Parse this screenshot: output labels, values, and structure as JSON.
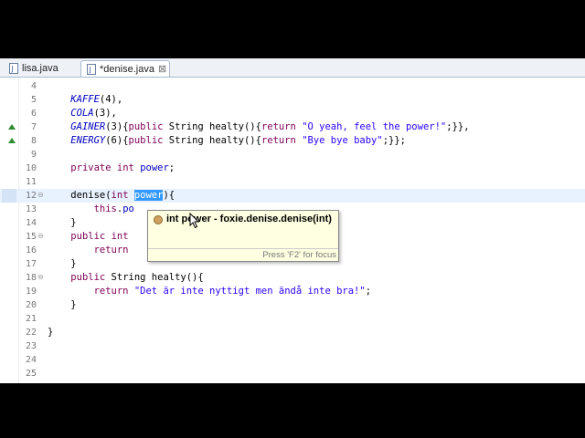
{
  "tabs": [
    {
      "label": "lisa.java",
      "active": false
    },
    {
      "label": "*denise.java",
      "active": true,
      "close": "⊠"
    }
  ],
  "editor": {
    "lines": [
      {
        "num": "4",
        "code": []
      },
      {
        "num": "5",
        "code": [
          {
            "t": "    "
          },
          {
            "t": "KAFFE",
            "c": "en"
          },
          {
            "t": "(4),"
          }
        ]
      },
      {
        "num": "6",
        "code": [
          {
            "t": "    "
          },
          {
            "t": "COLA",
            "c": "en"
          },
          {
            "t": "(3),"
          }
        ]
      },
      {
        "num": "7",
        "overrideMarker": true,
        "code": [
          {
            "t": "    "
          },
          {
            "t": "GAINER",
            "c": "en"
          },
          {
            "t": "(3){"
          },
          {
            "t": "public",
            "c": "kw"
          },
          {
            "t": " String healty(){"
          },
          {
            "t": "return",
            "c": "kw"
          },
          {
            "t": " "
          },
          {
            "t": "\"O yeah, feel the power!\"",
            "c": "st"
          },
          {
            "t": ";}},"
          }
        ]
      },
      {
        "num": "8",
        "overrideMarker": true,
        "code": [
          {
            "t": "    "
          },
          {
            "t": "ENERGY",
            "c": "en"
          },
          {
            "t": "(6){"
          },
          {
            "t": "public",
            "c": "kw"
          },
          {
            "t": " String healty(){"
          },
          {
            "t": "return",
            "c": "kw"
          },
          {
            "t": " "
          },
          {
            "t": "\"Bye bye baby\"",
            "c": "st"
          },
          {
            "t": ";}};"
          }
        ]
      },
      {
        "num": "9",
        "code": []
      },
      {
        "num": "10",
        "code": [
          {
            "t": "    "
          },
          {
            "t": "private",
            "c": "kw"
          },
          {
            "t": " "
          },
          {
            "t": "int",
            "c": "kw"
          },
          {
            "t": " "
          },
          {
            "t": "power",
            "c": "fd"
          },
          {
            "t": ";"
          }
        ]
      },
      {
        "num": "11",
        "code": []
      },
      {
        "num": "12",
        "current": true,
        "fold": "⊖",
        "code": [
          {
            "t": "    denise("
          },
          {
            "t": "int",
            "c": "kw"
          },
          {
            "t": " "
          },
          {
            "t": "power",
            "c": "sel"
          },
          {
            "t": "){"
          }
        ]
      },
      {
        "num": "13",
        "code": [
          {
            "t": "        "
          },
          {
            "t": "this",
            "c": "kw"
          },
          {
            "t": "."
          },
          {
            "t": "po",
            "c": "fd"
          }
        ]
      },
      {
        "num": "14",
        "code": [
          {
            "t": "    }"
          }
        ]
      },
      {
        "num": "15",
        "fold": "⊖",
        "code": [
          {
            "t": "    "
          },
          {
            "t": "public",
            "c": "kw"
          },
          {
            "t": " "
          },
          {
            "t": "int",
            "c": "kw"
          }
        ]
      },
      {
        "num": "16",
        "code": [
          {
            "t": "        "
          },
          {
            "t": "return",
            "c": "kw"
          }
        ]
      },
      {
        "num": "17",
        "code": [
          {
            "t": "    }"
          }
        ]
      },
      {
        "num": "18",
        "fold": "⊖",
        "code": [
          {
            "t": "    "
          },
          {
            "t": "public",
            "c": "kw"
          },
          {
            "t": " String healty(){"
          }
        ]
      },
      {
        "num": "19",
        "code": [
          {
            "t": "        "
          },
          {
            "t": "return",
            "c": "kw"
          },
          {
            "t": " "
          },
          {
            "t": "\"Det är inte nyttigt men ändå inte bra!\"",
            "c": "st"
          },
          {
            "t": ";"
          }
        ]
      },
      {
        "num": "20",
        "code": [
          {
            "t": "    }"
          }
        ]
      },
      {
        "num": "21",
        "code": []
      },
      {
        "num": "22",
        "code": [
          {
            "t": "}"
          }
        ]
      },
      {
        "num": "23",
        "code": []
      },
      {
        "num": "24",
        "code": []
      },
      {
        "num": "25",
        "code": []
      }
    ]
  },
  "popup": {
    "proposal": "int power - foxie.denise.denise(int)",
    "hint": "Press 'F2' for focus"
  }
}
